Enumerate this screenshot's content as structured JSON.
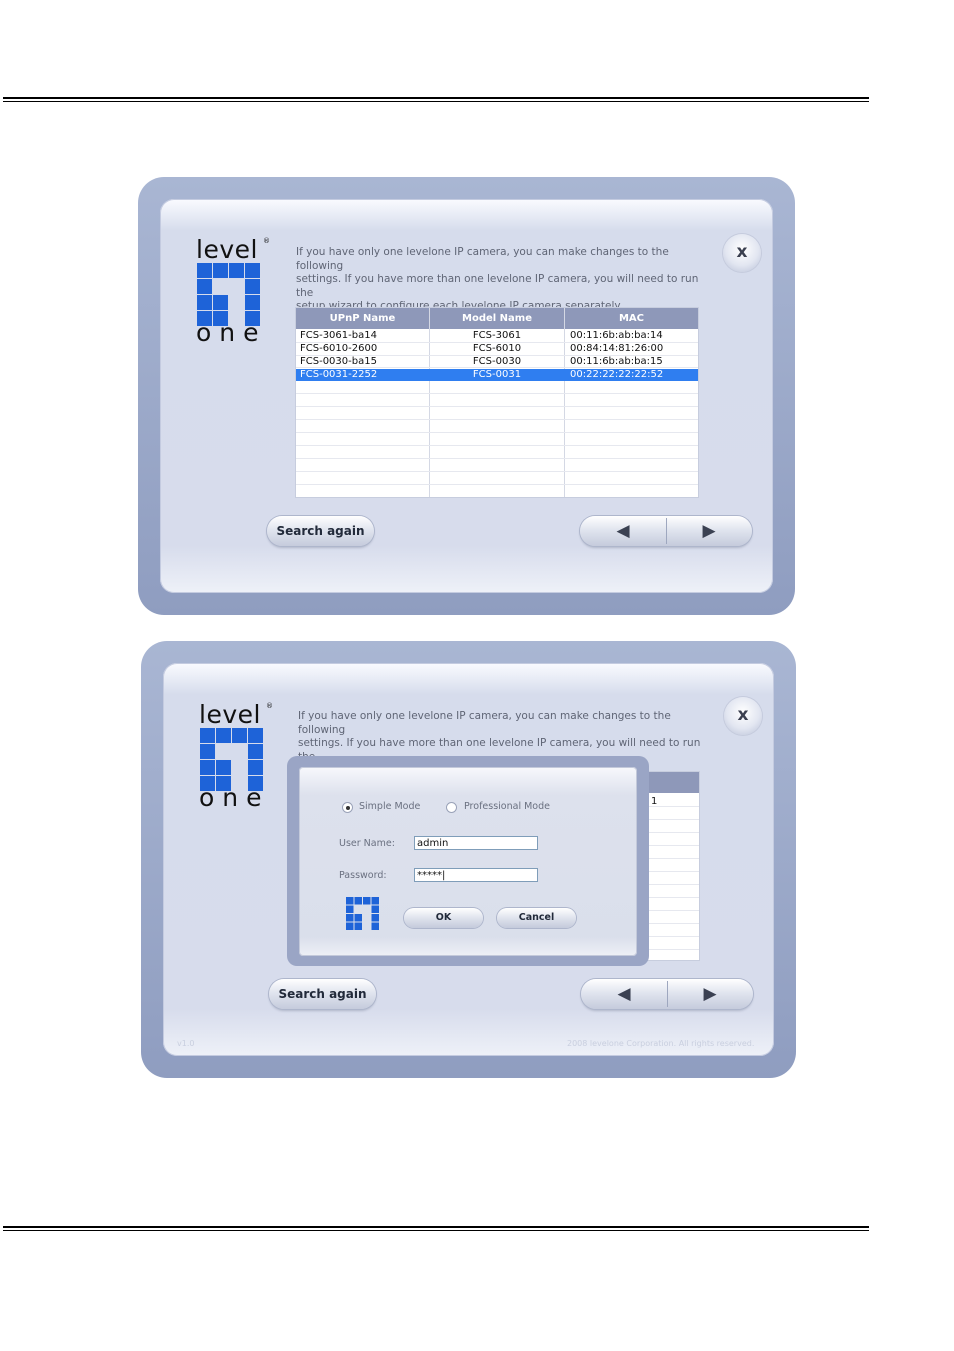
{
  "logo": {
    "top_word": "level",
    "reg_mark": "®",
    "bottom_word": "one"
  },
  "intro_text": "If you have only one levelone IP camera, you can make changes to the following\nsettings. If you have more than one levelone IP camera, you will need to run the\nsetup wizard to configure each levelone IP camera separately.",
  "close_label": "x",
  "table": {
    "columns": [
      "UPnP Name",
      "Model Name",
      "MAC"
    ],
    "rows": [
      [
        "FCS-3061-ba14",
        "FCS-3061",
        "00:11:6b:ab:ba:14"
      ],
      [
        "FCS-6010-2600",
        "FCS-6010",
        "00:84:14:81:26:00"
      ],
      [
        "FCS-0030-ba15",
        "FCS-0030",
        "00:11:6b:ab:ba:15"
      ],
      [
        "FCS-0031-2252",
        "FCS-0031",
        "00:22:22:22:22:52"
      ]
    ],
    "selected_row": 3,
    "partial_cell": "1"
  },
  "buttons": {
    "search_again": "Search again",
    "prev_glyph": "◀",
    "next_glyph": "▶"
  },
  "login_dialog": {
    "simple_mode": "Simple Mode",
    "professional_mode": "Professional Mode",
    "selected_mode": "Simple Mode",
    "user_name_label": "User Name:",
    "user_name_value": "admin",
    "password_label": "Password:",
    "password_value": "*****|",
    "ok": "OK",
    "cancel": "Cancel"
  },
  "footer": {
    "version": "v1.0",
    "copyright": "2008 levelone Corporation. All rights reserved."
  },
  "colors": {
    "accent": "#2f7ef0",
    "header": "#8e98b9",
    "logo_blue": "#1e63d8"
  }
}
